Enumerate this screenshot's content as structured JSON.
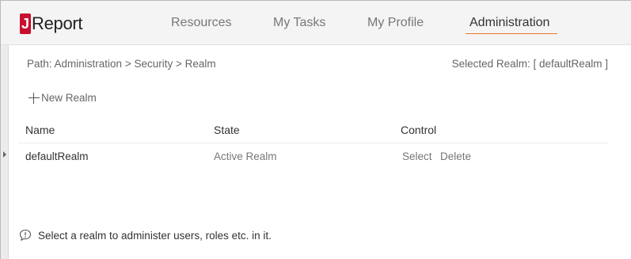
{
  "brand": {
    "mark": "J",
    "name": "Report",
    "accent": "#c8102e"
  },
  "nav": {
    "items": [
      {
        "label": "Resources"
      },
      {
        "label": "My Tasks"
      },
      {
        "label": "My Profile"
      },
      {
        "label": "Administration"
      }
    ],
    "active_index": 3,
    "underline_color": "#e8782a"
  },
  "breadcrumb": {
    "text": "Path: Administration > Security > Realm"
  },
  "selected_realm": {
    "text": "Selected Realm: [ defaultRealm ]"
  },
  "toolbar": {
    "new_realm_label": "New Realm",
    "icon": "plus-icon"
  },
  "table": {
    "columns": [
      "Name",
      "State",
      "Control"
    ],
    "rows": [
      {
        "name": "defaultRealm",
        "state": "Active Realm",
        "actions": [
          "Select",
          "Delete"
        ]
      }
    ]
  },
  "tip": {
    "icon": "info-bubble-icon",
    "text": "Select a realm to administer users, roles etc. in it."
  }
}
